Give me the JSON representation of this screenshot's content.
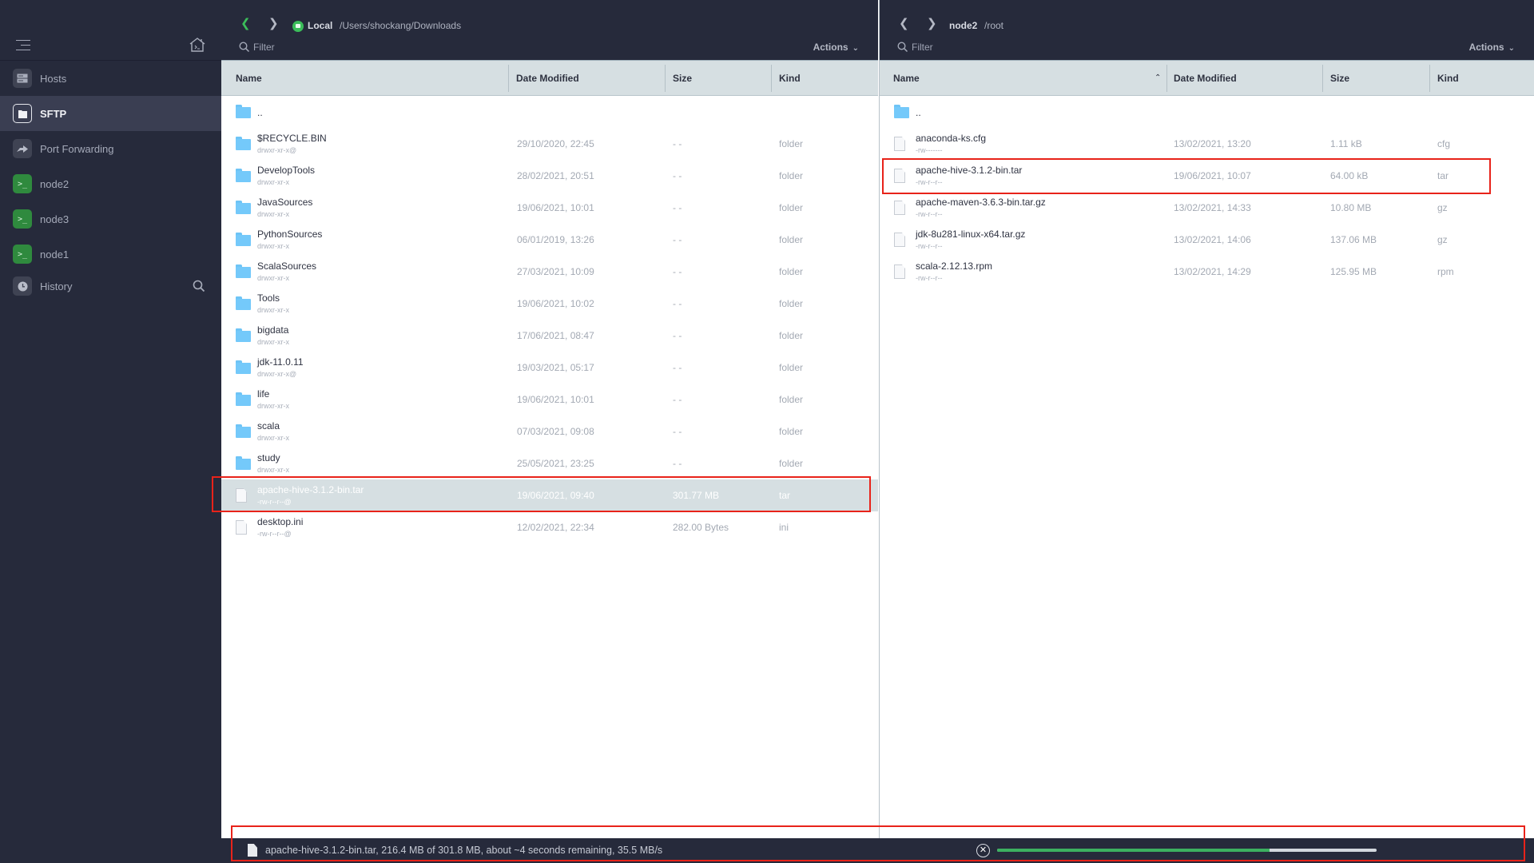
{
  "sidebar": {
    "items": [
      {
        "label": "Hosts",
        "icon": "hosts-icon",
        "active": false
      },
      {
        "label": "SFTP",
        "icon": "sftp-folder-icon",
        "active": true
      },
      {
        "label": "Port Forwarding",
        "icon": "port-forwarding-icon",
        "active": false
      },
      {
        "label": "node2",
        "icon": "terminal-icon",
        "active": false
      },
      {
        "label": "node3",
        "icon": "terminal-icon",
        "active": false
      },
      {
        "label": "node1",
        "icon": "terminal-icon",
        "active": false
      },
      {
        "label": "History",
        "icon": "history-clock-icon",
        "active": false
      }
    ],
    "terminal_glyph": ">_"
  },
  "left_pane": {
    "host": "Local",
    "path": "/Users/shockang/Downloads",
    "filter_placeholder": "Filter",
    "actions_label": "Actions",
    "columns": [
      "Name",
      "Date Modified",
      "Size",
      "Kind"
    ],
    "rows": [
      {
        "name": "..",
        "perm": "",
        "date": "",
        "size": "",
        "kind": "",
        "type": "folder",
        "selected": false
      },
      {
        "name": "$RECYCLE.BIN",
        "perm": "drwxr-xr-x@",
        "date": "29/10/2020, 22:45",
        "size": "- -",
        "kind": "folder",
        "type": "folder",
        "selected": false
      },
      {
        "name": "DevelopTools",
        "perm": "drwxr-xr-x",
        "date": "28/02/2021, 20:51",
        "size": "- -",
        "kind": "folder",
        "type": "folder",
        "selected": false
      },
      {
        "name": "JavaSources",
        "perm": "drwxr-xr-x",
        "date": "19/06/2021, 10:01",
        "size": "- -",
        "kind": "folder",
        "type": "folder",
        "selected": false
      },
      {
        "name": "PythonSources",
        "perm": "drwxr-xr-x",
        "date": "06/01/2019, 13:26",
        "size": "- -",
        "kind": "folder",
        "type": "folder",
        "selected": false
      },
      {
        "name": "ScalaSources",
        "perm": "drwxr-xr-x",
        "date": "27/03/2021, 10:09",
        "size": "- -",
        "kind": "folder",
        "type": "folder",
        "selected": false
      },
      {
        "name": "Tools",
        "perm": "drwxr-xr-x",
        "date": "19/06/2021, 10:02",
        "size": "- -",
        "kind": "folder",
        "type": "folder",
        "selected": false
      },
      {
        "name": "bigdata",
        "perm": "drwxr-xr-x",
        "date": "17/06/2021, 08:47",
        "size": "- -",
        "kind": "folder",
        "type": "folder",
        "selected": false
      },
      {
        "name": "jdk-11.0.11",
        "perm": "drwxr-xr-x@",
        "date": "19/03/2021, 05:17",
        "size": "- -",
        "kind": "folder",
        "type": "folder",
        "selected": false
      },
      {
        "name": "life",
        "perm": "drwxr-xr-x",
        "date": "19/06/2021, 10:01",
        "size": "- -",
        "kind": "folder",
        "type": "folder",
        "selected": false
      },
      {
        "name": "scala",
        "perm": "drwxr-xr-x",
        "date": "07/03/2021, 09:08",
        "size": "- -",
        "kind": "folder",
        "type": "folder",
        "selected": false
      },
      {
        "name": "study",
        "perm": "drwxr-xr-x",
        "date": "25/05/2021, 23:25",
        "size": "- -",
        "kind": "folder",
        "type": "folder",
        "selected": false
      },
      {
        "name": "apache-hive-3.1.2-bin.tar",
        "perm": "-rw-r--r--@",
        "date": "19/06/2021, 09:40",
        "size": "301.77 MB",
        "kind": "tar",
        "type": "file",
        "selected": true
      },
      {
        "name": "desktop.ini",
        "perm": "-rw-r--r--@",
        "date": "12/02/2021, 22:34",
        "size": "282.00 Bytes",
        "kind": "ini",
        "type": "file",
        "selected": false
      }
    ]
  },
  "right_pane": {
    "host": "node2",
    "path": "/root",
    "filter_placeholder": "Filter",
    "actions_label": "Actions",
    "columns": [
      "Name",
      "Date Modified",
      "Size",
      "Kind"
    ],
    "sort_column": "Name",
    "sort_direction": "ascending",
    "rows": [
      {
        "name": "..",
        "perm": "",
        "date": "",
        "size": "",
        "kind": "",
        "type": "folder"
      },
      {
        "name": "anaconda-ks.cfg",
        "perm": "-rw-------",
        "date": "13/02/2021, 13:20",
        "size": "1.11 kB",
        "kind": "cfg",
        "type": "file"
      },
      {
        "name": "apache-hive-3.1.2-bin.tar",
        "perm": "-rw-r--r--",
        "date": "19/06/2021, 10:07",
        "size": "64.00 kB",
        "kind": "tar",
        "type": "file"
      },
      {
        "name": "apache-maven-3.6.3-bin.tar.gz",
        "perm": "-rw-r--r--",
        "date": "13/02/2021, 14:33",
        "size": "10.80 MB",
        "kind": "gz",
        "type": "file"
      },
      {
        "name": "jdk-8u281-linux-x64.tar.gz",
        "perm": "-rw-r--r--",
        "date": "13/02/2021, 14:06",
        "size": "137.06 MB",
        "kind": "gz",
        "type": "file"
      },
      {
        "name": "scala-2.12.13.rpm",
        "perm": "-rw-r--r--",
        "date": "13/02/2021, 14:29",
        "size": "125.95 MB",
        "kind": "rpm",
        "type": "file"
      }
    ]
  },
  "transfer": {
    "text": "apache-hive-3.1.2-bin.tar, 216.4 MB of 301.8 MB, about ~4 seconds remaining, 35.5 MB/s",
    "progress": 0.717,
    "cancel_glyph": "✕"
  },
  "colors": {
    "accent_green": "#3bbd5a",
    "progress_green": "#3cb060",
    "annotation_red": "#e8231a",
    "sidebar_bg": "#262a3b"
  }
}
